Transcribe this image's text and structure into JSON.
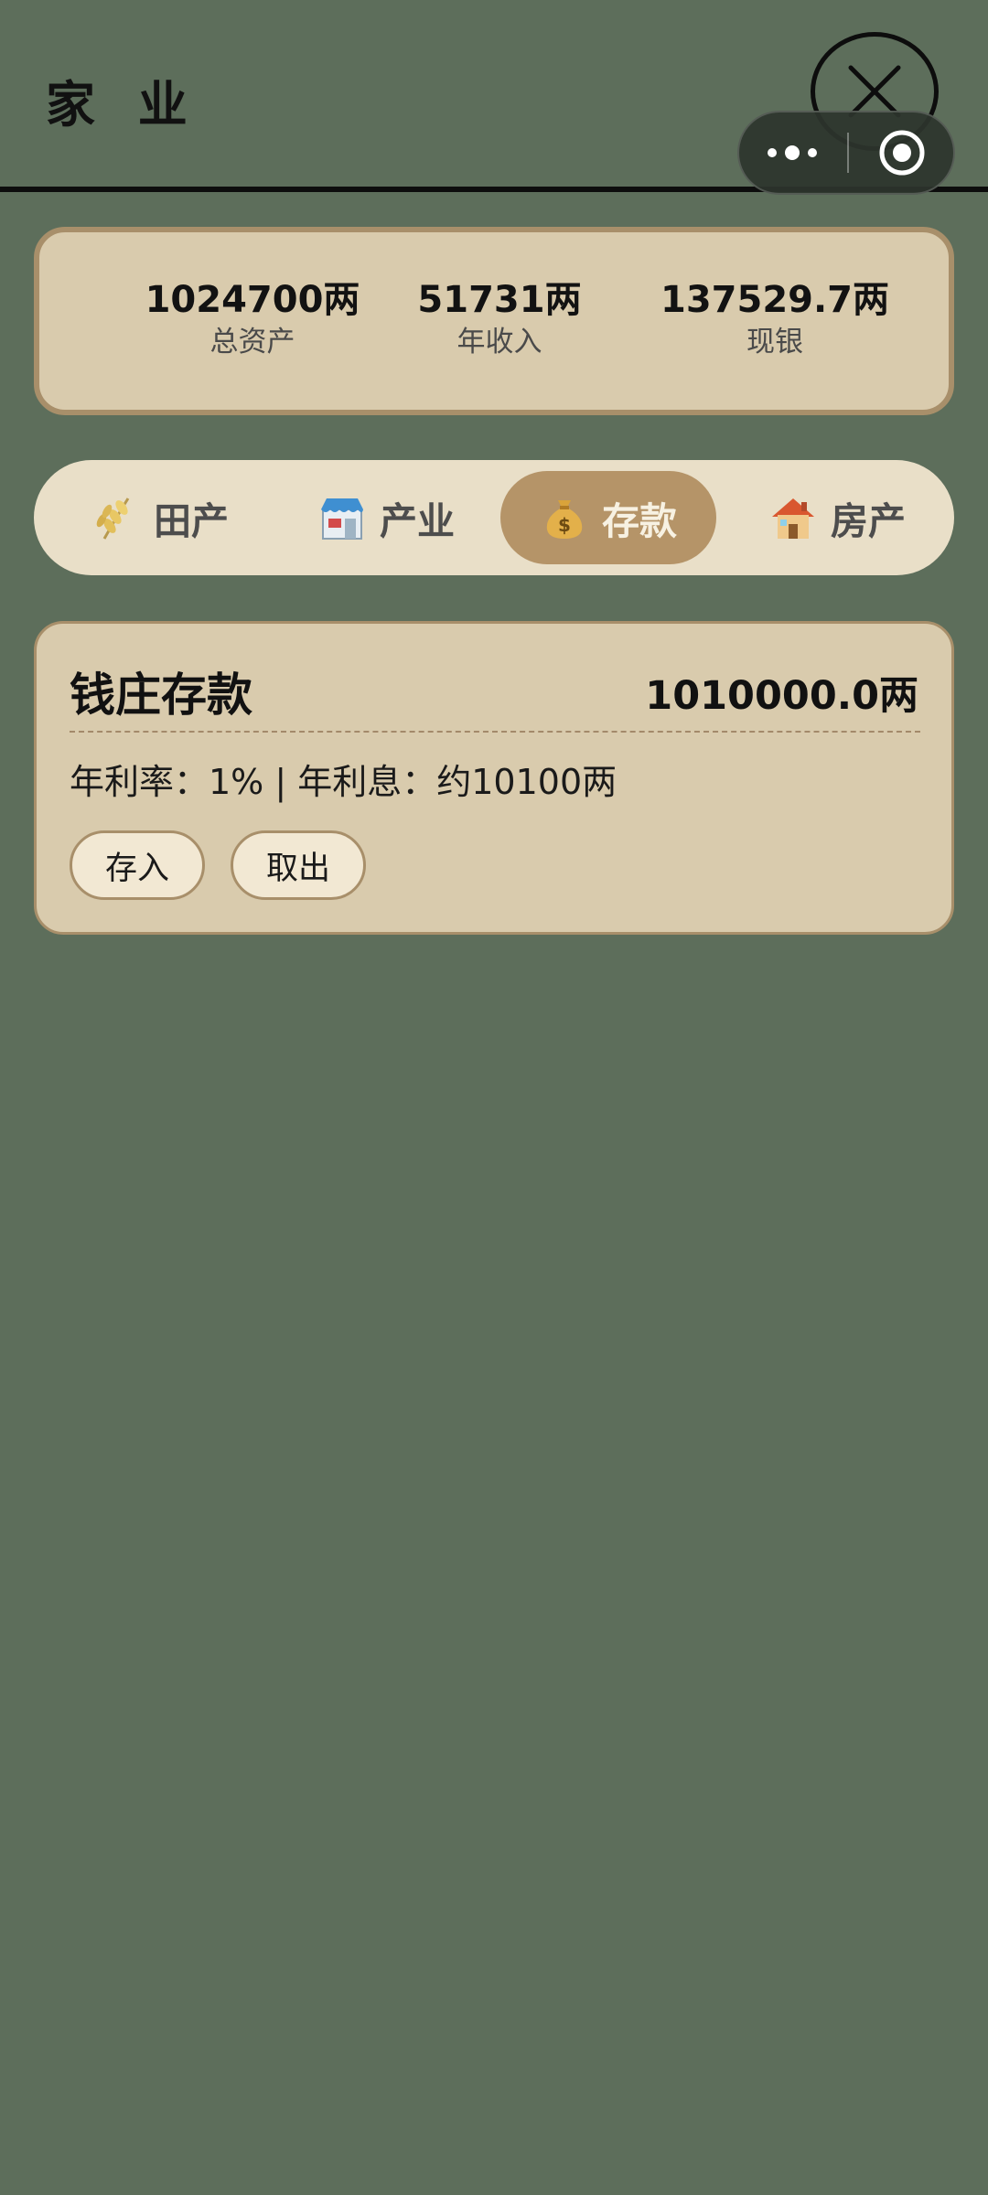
{
  "header": {
    "title": "家 业"
  },
  "summary": {
    "total_assets": {
      "value": "1024700两",
      "label": "总资产"
    },
    "annual_income": {
      "value": "51731两",
      "label": "年收入"
    },
    "cash": {
      "value": "137529.7两",
      "label": "现银"
    }
  },
  "tabs": [
    {
      "label": "田产",
      "icon": "wheat-icon",
      "active": false
    },
    {
      "label": "产业",
      "icon": "shop-icon",
      "active": false
    },
    {
      "label": "存款",
      "icon": "money-bag-icon",
      "active": true
    },
    {
      "label": "房产",
      "icon": "house-icon",
      "active": false
    }
  ],
  "deposit": {
    "title": "钱庄存款",
    "amount": "1010000.0两",
    "rate_text": "年利率：1% | 年利息：约10100两",
    "buttons": {
      "deposit": "存入",
      "withdraw": "取出"
    }
  },
  "colors": {
    "background": "#5d6e5b",
    "card": "#d9cbad",
    "card_border": "#a88f6a",
    "tab_bar": "#e9dfc8",
    "tab_active": "#b59468"
  }
}
